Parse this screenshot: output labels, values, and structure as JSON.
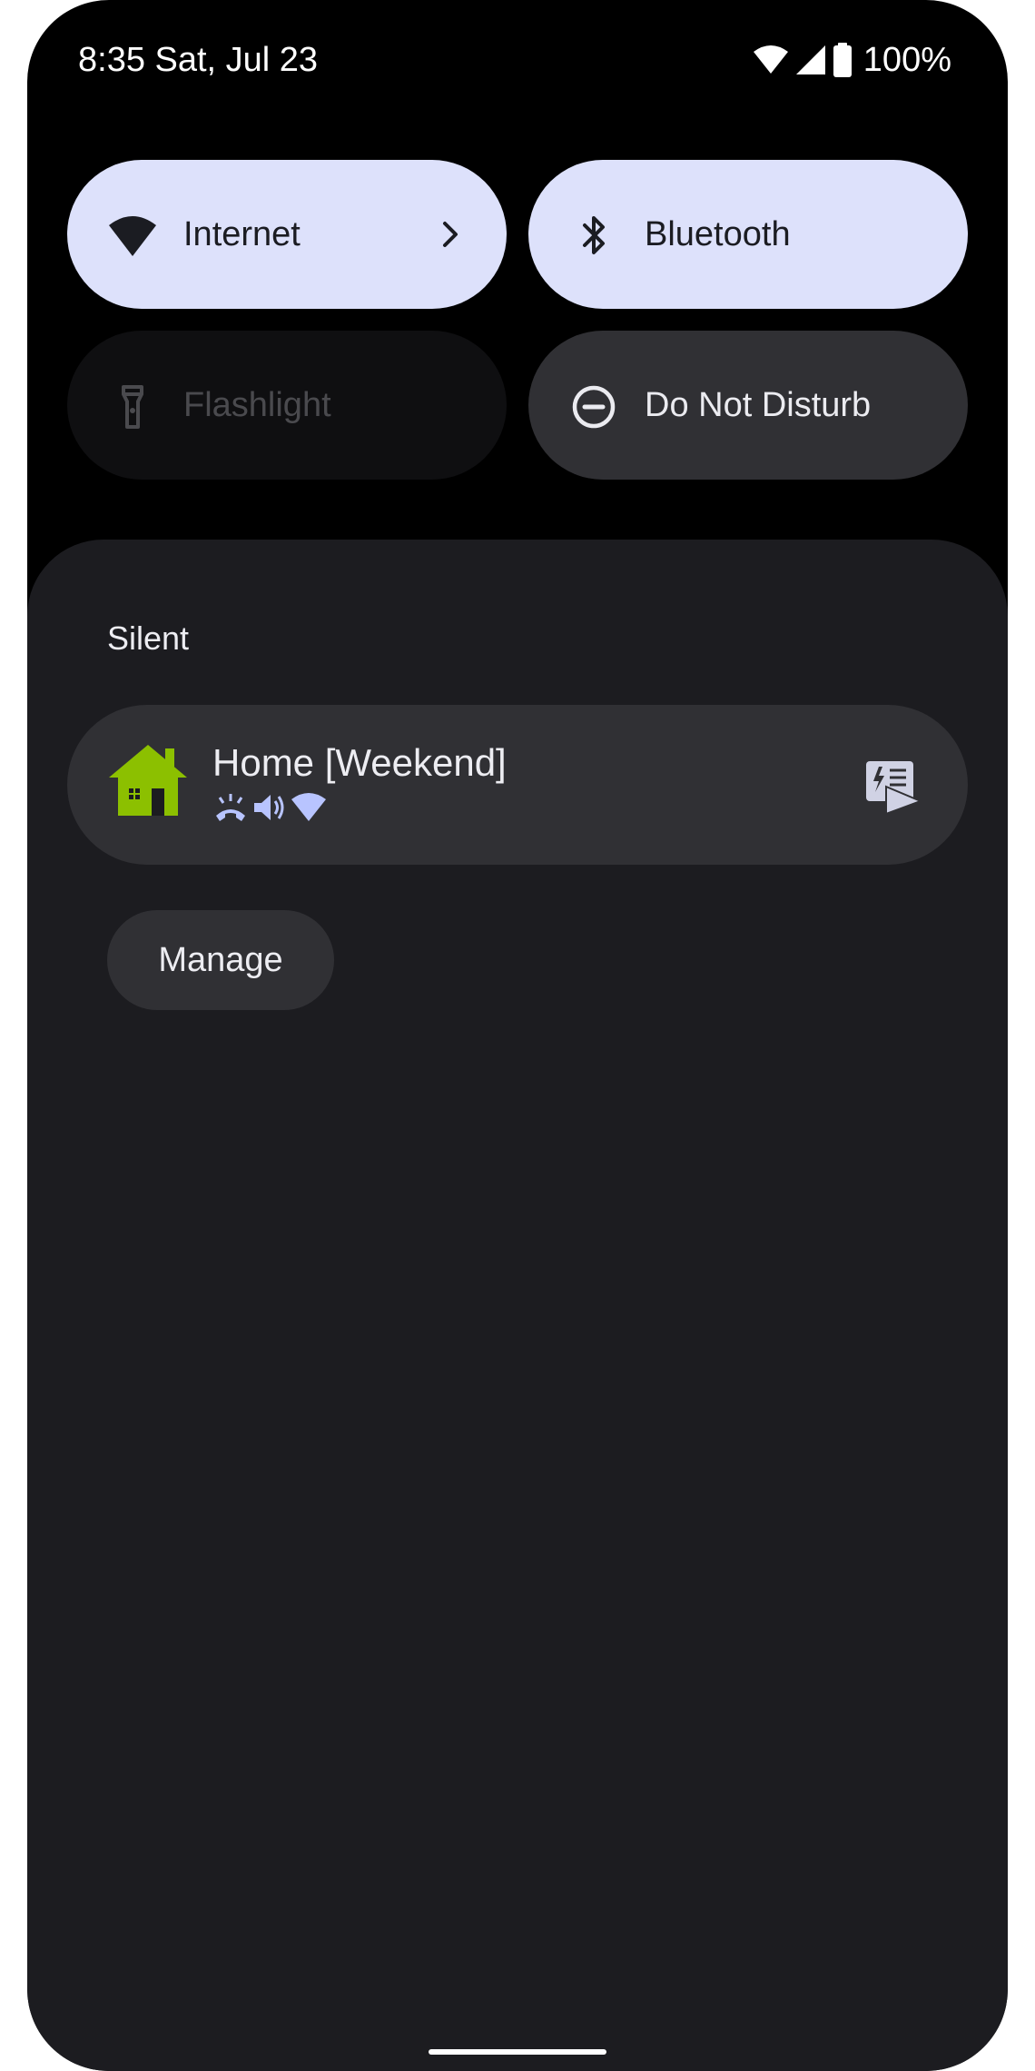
{
  "status_bar": {
    "time_date": "8:35 Sat, Jul 23",
    "battery_text": "100%",
    "icons": [
      "wifi-icon",
      "cellular-signal-icon",
      "battery-icon"
    ]
  },
  "quick_settings": {
    "tiles": [
      {
        "label": "Internet",
        "icon": "wifi-icon",
        "state": "on",
        "has_chevron": true
      },
      {
        "label": "Bluetooth",
        "icon": "bluetooth-icon",
        "state": "on"
      },
      {
        "label": "Flashlight",
        "icon": "flashlight-icon",
        "state": "unavailable"
      },
      {
        "label": "Do Not Disturb",
        "icon": "do-not-disturb-icon",
        "state": "off"
      }
    ]
  },
  "notifications": {
    "section_label": "Silent",
    "items": [
      {
        "app_icon": "home-icon",
        "title": "Home [Weekend]",
        "status_icons": [
          "ringer-vibrate-icon",
          "volume-icon",
          "wifi-icon"
        ],
        "action_icon": "tasker-action-icon"
      }
    ],
    "manage_label": "Manage"
  },
  "colors": {
    "active_tile": "#dde1fb",
    "inactive_tile": "#303034",
    "sheet_background": "#1c1c20",
    "home_icon": "#8cc000",
    "status_icon_accent": "#b8c4ff"
  }
}
